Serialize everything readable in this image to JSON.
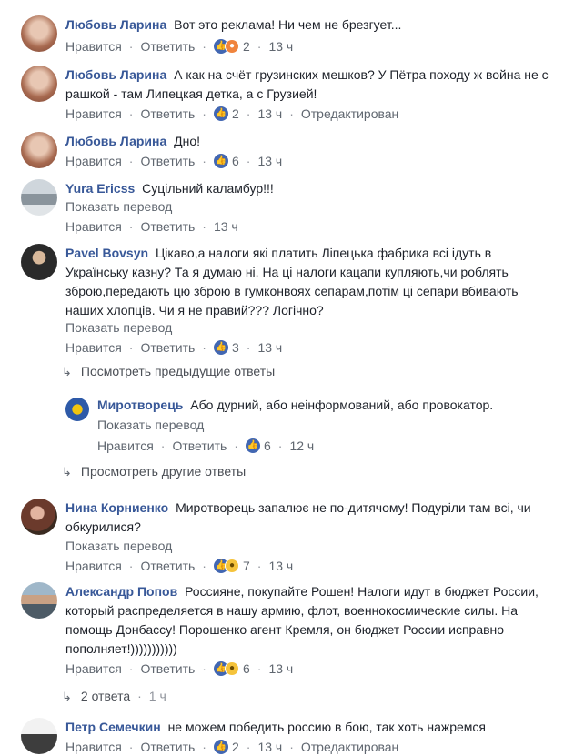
{
  "ui": {
    "like": "Нравится",
    "reply": "Ответить",
    "translate": "Показать перевод",
    "edited": "Отредактирован"
  },
  "comments": [
    {
      "name": "Любовь Ларина",
      "text": "Вот это реклама! Ни чем не брезгует...",
      "count": "2",
      "time": "13 ч"
    },
    {
      "name": "Любовь Ларина",
      "text": "А как на счёт грузинских мешков? У Пётра походу ж война не с рашкой - там Липецкая детка, а с Грузией!",
      "count": "2",
      "time": "13 ч"
    },
    {
      "name": "Любовь Ларина",
      "text": "Дно!",
      "count": "6",
      "time": "13 ч"
    },
    {
      "name": "Yura Ericss",
      "text": "Суцільний каламбур!!!",
      "time": "13 ч"
    },
    {
      "name": "Pavel Bovsyn",
      "text": "Цікаво,а налоги які платить Ліпецька фабрика всі ідуть в Українську казну? Та я думаю ні. На ці налоги кацапи купляють,чи роблять зброю,передають цю зброю в гумконвоях сепарам,потім ці сепари вбивають наших хлопців. Чи я не правий??? Логічно?",
      "count": "3",
      "time": "13 ч"
    },
    {
      "name": "Миротворець",
      "text": "Або дурний, або неінформований, або провокатор.",
      "count": "6",
      "time": "12 ч"
    },
    {
      "name": "Нина Корниенко",
      "text": "Миротворець запалює не по-дитячому! Подуріли там всі, чи обкурилися?",
      "count": "7",
      "time": "13 ч"
    },
    {
      "name": "Александр Попов",
      "text": "Россияне, покупайте Рошен! Налоги идут в бюджет России, который распределяется в нашу армию, флот, военнокосмические силы. На помощь Донбассу! Порошенко агент Кремля, он бюджет России исправно пополняет!)))))))))))",
      "count": "6",
      "time": "13 ч"
    },
    {
      "name": "Петр Семечкин",
      "text": "не можем победить россию в бою, так хоть нажремся",
      "count": "2",
      "time": "13 ч"
    }
  ],
  "thread": {
    "prev_replies": "Посмотреть предыдущие ответы",
    "other_replies": "Просмотреть другие ответы",
    "replies_count": "2 ответа",
    "replies_time": "1 ч"
  },
  "icons": {
    "like": "thumbs-up-icon",
    "haha": "haha-emoji-icon",
    "angry": "angry-emoji-icon",
    "reply_arrow": "reply-arrow-icon"
  },
  "colors": {
    "link": "#385898",
    "meta": "#606770",
    "like": "#4267b2"
  }
}
